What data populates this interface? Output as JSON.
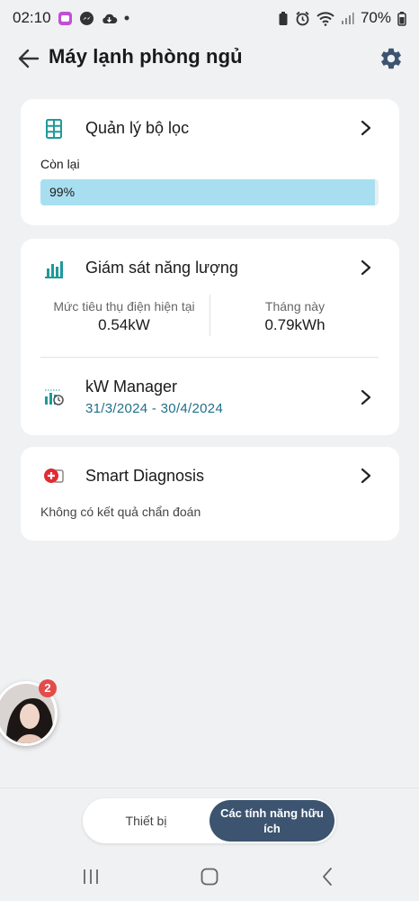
{
  "status_bar": {
    "time": "02:10",
    "battery": "70%"
  },
  "header": {
    "title": "Máy lạnh phòng ngủ"
  },
  "filter_card": {
    "label": "Quản lý bộ lọc",
    "remaining_label": "Còn lại",
    "progress_text": "99%",
    "progress_percent": 99
  },
  "energy_card": {
    "label": "Giám sát năng lượng",
    "current_caption": "Mức tiêu thụ điện hiện tại",
    "current_value": "0.54kW",
    "month_caption": "Tháng này",
    "month_value": "0.79kWh",
    "kw_manager_label": "kW Manager",
    "date_range": "31/3/2024 - 30/4/2024"
  },
  "diagnosis_card": {
    "label": "Smart Diagnosis",
    "result_text": "Không có kết quả chẩn đoán"
  },
  "floating_avatar": {
    "badge_count": "2"
  },
  "bottom_tabs": {
    "device_label": "Thiết bị",
    "features_label": "Các tính năng hữu ích"
  },
  "colors": {
    "accent_teal": "#1f9a9a",
    "tab_active": "#3c5470",
    "progress_fill": "#a8dff0",
    "badge": "#e34b4b"
  }
}
